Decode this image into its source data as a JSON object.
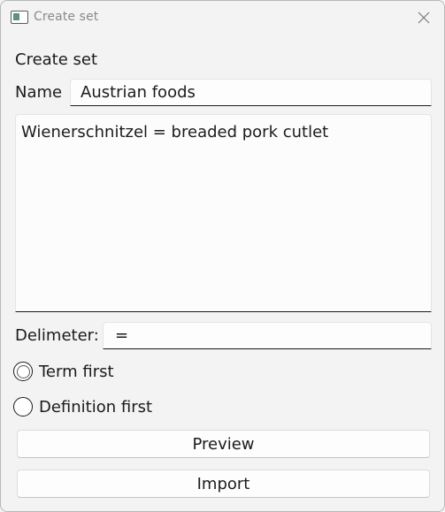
{
  "window": {
    "title": "Create set",
    "icon": "app-window-icon",
    "close_icon": "close-icon"
  },
  "form": {
    "heading": "Create set",
    "name_label": "Name",
    "name_value": "Austrian foods",
    "terms_text": "Wienerschnitzel = breaded pork cutlet",
    "delimiter_label": "Delimeter:",
    "delimiter_value": "=",
    "radio_options": [
      {
        "label": "Term first",
        "checked": true
      },
      {
        "label": "Definition first",
        "checked": false
      }
    ],
    "preview_label": "Preview",
    "import_label": "Import"
  },
  "colors": {
    "background": "#f3f3f3",
    "text": "#1b1b1b",
    "title_text": "#8a8a8a",
    "input_underline": "#1b1b1b"
  }
}
